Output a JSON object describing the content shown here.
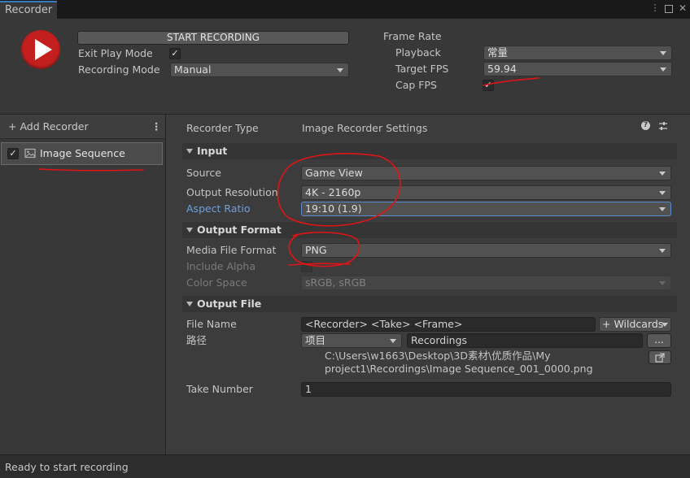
{
  "window": {
    "tab_title": "Recorder"
  },
  "top": {
    "start_button": "START RECORDING",
    "exit_play_mode_label": "Exit Play Mode",
    "exit_play_mode_checked": true,
    "recording_mode_label": "Recording Mode",
    "recording_mode_value": "Manual",
    "frame_rate_title": "Frame Rate",
    "playback_label": "Playback",
    "playback_value": "常量",
    "target_fps_label": "Target FPS",
    "target_fps_value": "59.94",
    "cap_fps_label": "Cap FPS",
    "cap_fps_checked": true
  },
  "left": {
    "add_recorder": "+ Add Recorder",
    "recorders": [
      {
        "label": "Image Sequence",
        "enabled": true
      }
    ]
  },
  "settings": {
    "recorder_type_label": "Recorder Type",
    "recorder_type_value": "Image Recorder Settings",
    "input": {
      "title": "Input",
      "source_label": "Source",
      "source_value": "Game View",
      "resolution_label": "Output Resolution",
      "resolution_value": "4K - 2160p",
      "aspect_label": "Aspect Ratio",
      "aspect_value": "19:10 (1.9)"
    },
    "output_format": {
      "title": "Output Format",
      "media_label": "Media File Format",
      "media_value": "PNG",
      "alpha_label": "Include Alpha",
      "colorspace_label": "Color Space",
      "colorspace_value": "sRGB, sRGB"
    },
    "output_file": {
      "title": "Output File",
      "filename_label": "File Name",
      "filename_value": "<Recorder>  <Take>  <Frame>",
      "wildcards_label": "+ Wildcards",
      "path_label": "路径",
      "path_root_value": "项目",
      "path_folder_value": "Recordings",
      "browse_label": "...",
      "full_path_line1": "C:\\Users\\w1663\\Desktop\\3D素材\\优质作品\\My",
      "full_path_line2": "project1\\Recordings\\Image Sequence_001_0000.png",
      "take_label": "Take Number",
      "take_value": "1"
    }
  },
  "status": {
    "text": "Ready to start recording"
  },
  "colors": {
    "record_button": "#c41f1f",
    "annotation_red": "#e01414",
    "link_blue": "#6f9fe0"
  }
}
